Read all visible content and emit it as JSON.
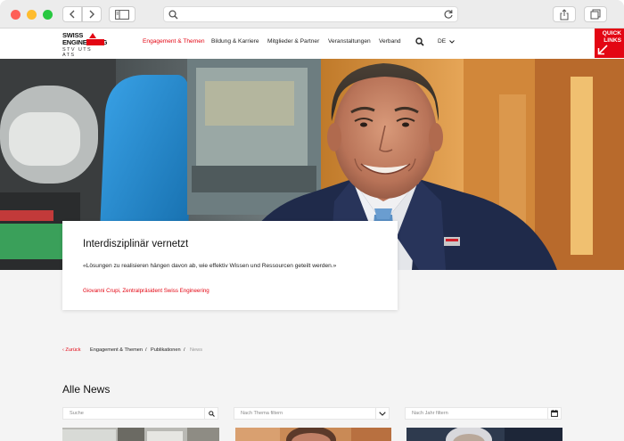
{
  "site": {
    "logo_line1": "SWISS",
    "logo_line2": "ENGINEERING",
    "logo_line3": "STV  UTS  ATS",
    "nav": [
      {
        "label": "Engagement & Themen"
      },
      {
        "label": "Bildung & Karriere"
      },
      {
        "label": "Mitglieder & Partner"
      },
      {
        "label": "Veranstaltungen"
      },
      {
        "label": "Verband"
      }
    ],
    "language": "DE",
    "quick_links_line1": "QUICK",
    "quick_links_line2": "LINKS"
  },
  "hero": {
    "title": "Interdisziplinär vernetzt",
    "quote": "«Lösungen zu realisieren hängen davon ab, wie effektiv Wissen und Ressourcen geteilt werden.»",
    "author": "Giovanni Crupi, Zentralpräsident Swiss Engineering"
  },
  "breadcrumb": {
    "back": "Zurück",
    "items": [
      "Engagement & Themen",
      "Publikationen",
      "News"
    ]
  },
  "news": {
    "title": "Alle News",
    "search_placeholder": "Suche",
    "topic_placeholder": "Nach Thema filtern",
    "year_placeholder": "Nach Jahr filtern"
  },
  "colors": {
    "accent": "#e30613",
    "background": "#f4f4f4"
  }
}
